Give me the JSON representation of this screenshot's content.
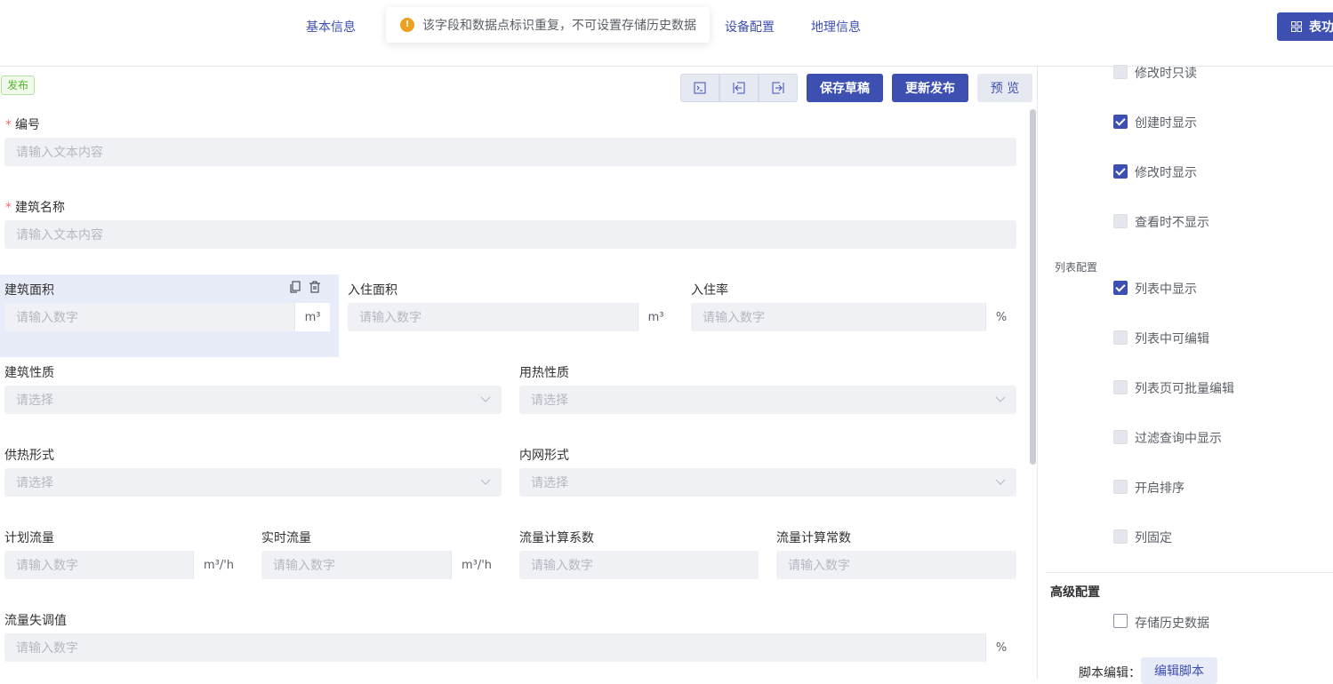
{
  "nav": {
    "tabs": [
      "基本信息",
      "设备配置",
      "地理信息"
    ],
    "toast": "该字段和数据点标识重复，不可设置存储历史数据",
    "table_btn": "表功"
  },
  "form": {
    "status_badge": "发布",
    "buttons": {
      "save_draft": "保存草稿",
      "update_publish": "更新发布",
      "preview": "预 览"
    },
    "text_placeholder": "请输入文本内容",
    "num_placeholder": "请输入数字",
    "select_placeholder": "请选择",
    "fields": {
      "code": "编号",
      "building_name": "建筑名称",
      "building_area": "建筑面积",
      "occupied_area": "入住面积",
      "occupancy_rate": "入住率",
      "building_nature": "建筑性质",
      "heat_nature": "用热性质",
      "heating_form": "供热形式",
      "network_form": "内网形式",
      "planned_flow": "计划流量",
      "realtime_flow": "实时流量",
      "flow_coef": "流量计算系数",
      "flow_const": "流量计算常数",
      "flow_imbalance": "流量失调值"
    },
    "units": {
      "area": "m³",
      "percent": "%",
      "flow": "m³/'h"
    }
  },
  "panel": {
    "items": [
      {
        "label": "修改时只读",
        "checked": false
      },
      {
        "label": "创建时显示",
        "checked": true
      },
      {
        "label": "修改时显示",
        "checked": true
      },
      {
        "label": "查看时不显示",
        "checked": false
      }
    ],
    "list_section": "列表配置",
    "list_items": [
      {
        "label": "列表中显示",
        "checked": true
      },
      {
        "label": "列表中可编辑",
        "checked": false
      },
      {
        "label": "列表页可批量编辑",
        "checked": false
      },
      {
        "label": "过滤查询中显示",
        "checked": false
      },
      {
        "label": "开启排序",
        "checked": false
      },
      {
        "label": "列固定",
        "checked": false
      }
    ],
    "advanced_section": "高级配置",
    "store_history": "存储历史数据",
    "script_label": "脚本编辑：",
    "edit_script": "编辑脚本"
  }
}
